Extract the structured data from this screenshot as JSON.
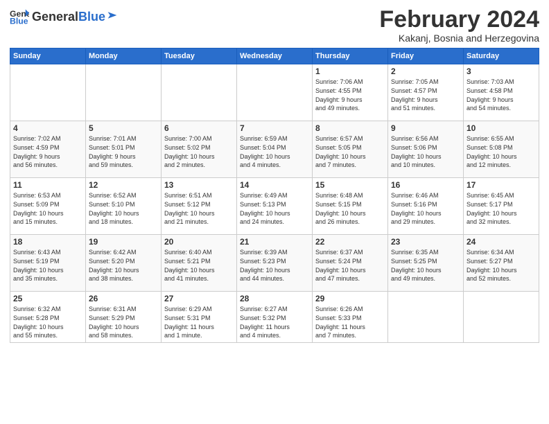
{
  "header": {
    "logo_general": "General",
    "logo_blue": "Blue",
    "month_title": "February 2024",
    "location": "Kakanj, Bosnia and Herzegovina"
  },
  "weekdays": [
    "Sunday",
    "Monday",
    "Tuesday",
    "Wednesday",
    "Thursday",
    "Friday",
    "Saturday"
  ],
  "weeks": [
    [
      {
        "day": "",
        "info": ""
      },
      {
        "day": "",
        "info": ""
      },
      {
        "day": "",
        "info": ""
      },
      {
        "day": "",
        "info": ""
      },
      {
        "day": "1",
        "info": "Sunrise: 7:06 AM\nSunset: 4:55 PM\nDaylight: 9 hours\nand 49 minutes."
      },
      {
        "day": "2",
        "info": "Sunrise: 7:05 AM\nSunset: 4:57 PM\nDaylight: 9 hours\nand 51 minutes."
      },
      {
        "day": "3",
        "info": "Sunrise: 7:03 AM\nSunset: 4:58 PM\nDaylight: 9 hours\nand 54 minutes."
      }
    ],
    [
      {
        "day": "4",
        "info": "Sunrise: 7:02 AM\nSunset: 4:59 PM\nDaylight: 9 hours\nand 56 minutes."
      },
      {
        "day": "5",
        "info": "Sunrise: 7:01 AM\nSunset: 5:01 PM\nDaylight: 9 hours\nand 59 minutes."
      },
      {
        "day": "6",
        "info": "Sunrise: 7:00 AM\nSunset: 5:02 PM\nDaylight: 10 hours\nand 2 minutes."
      },
      {
        "day": "7",
        "info": "Sunrise: 6:59 AM\nSunset: 5:04 PM\nDaylight: 10 hours\nand 4 minutes."
      },
      {
        "day": "8",
        "info": "Sunrise: 6:57 AM\nSunset: 5:05 PM\nDaylight: 10 hours\nand 7 minutes."
      },
      {
        "day": "9",
        "info": "Sunrise: 6:56 AM\nSunset: 5:06 PM\nDaylight: 10 hours\nand 10 minutes."
      },
      {
        "day": "10",
        "info": "Sunrise: 6:55 AM\nSunset: 5:08 PM\nDaylight: 10 hours\nand 12 minutes."
      }
    ],
    [
      {
        "day": "11",
        "info": "Sunrise: 6:53 AM\nSunset: 5:09 PM\nDaylight: 10 hours\nand 15 minutes."
      },
      {
        "day": "12",
        "info": "Sunrise: 6:52 AM\nSunset: 5:10 PM\nDaylight: 10 hours\nand 18 minutes."
      },
      {
        "day": "13",
        "info": "Sunrise: 6:51 AM\nSunset: 5:12 PM\nDaylight: 10 hours\nand 21 minutes."
      },
      {
        "day": "14",
        "info": "Sunrise: 6:49 AM\nSunset: 5:13 PM\nDaylight: 10 hours\nand 24 minutes."
      },
      {
        "day": "15",
        "info": "Sunrise: 6:48 AM\nSunset: 5:15 PM\nDaylight: 10 hours\nand 26 minutes."
      },
      {
        "day": "16",
        "info": "Sunrise: 6:46 AM\nSunset: 5:16 PM\nDaylight: 10 hours\nand 29 minutes."
      },
      {
        "day": "17",
        "info": "Sunrise: 6:45 AM\nSunset: 5:17 PM\nDaylight: 10 hours\nand 32 minutes."
      }
    ],
    [
      {
        "day": "18",
        "info": "Sunrise: 6:43 AM\nSunset: 5:19 PM\nDaylight: 10 hours\nand 35 minutes."
      },
      {
        "day": "19",
        "info": "Sunrise: 6:42 AM\nSunset: 5:20 PM\nDaylight: 10 hours\nand 38 minutes."
      },
      {
        "day": "20",
        "info": "Sunrise: 6:40 AM\nSunset: 5:21 PM\nDaylight: 10 hours\nand 41 minutes."
      },
      {
        "day": "21",
        "info": "Sunrise: 6:39 AM\nSunset: 5:23 PM\nDaylight: 10 hours\nand 44 minutes."
      },
      {
        "day": "22",
        "info": "Sunrise: 6:37 AM\nSunset: 5:24 PM\nDaylight: 10 hours\nand 47 minutes."
      },
      {
        "day": "23",
        "info": "Sunrise: 6:35 AM\nSunset: 5:25 PM\nDaylight: 10 hours\nand 49 minutes."
      },
      {
        "day": "24",
        "info": "Sunrise: 6:34 AM\nSunset: 5:27 PM\nDaylight: 10 hours\nand 52 minutes."
      }
    ],
    [
      {
        "day": "25",
        "info": "Sunrise: 6:32 AM\nSunset: 5:28 PM\nDaylight: 10 hours\nand 55 minutes."
      },
      {
        "day": "26",
        "info": "Sunrise: 6:31 AM\nSunset: 5:29 PM\nDaylight: 10 hours\nand 58 minutes."
      },
      {
        "day": "27",
        "info": "Sunrise: 6:29 AM\nSunset: 5:31 PM\nDaylight: 11 hours\nand 1 minute."
      },
      {
        "day": "28",
        "info": "Sunrise: 6:27 AM\nSunset: 5:32 PM\nDaylight: 11 hours\nand 4 minutes."
      },
      {
        "day": "29",
        "info": "Sunrise: 6:26 AM\nSunset: 5:33 PM\nDaylight: 11 hours\nand 7 minutes."
      },
      {
        "day": "",
        "info": ""
      },
      {
        "day": "",
        "info": ""
      }
    ]
  ]
}
